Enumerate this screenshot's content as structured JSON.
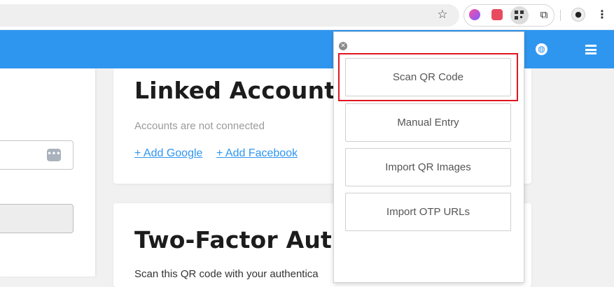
{
  "browser": {
    "icons": [
      "star-icon",
      "extension-icon",
      "extension-icon",
      "qr-extension-icon",
      "puzzle-icon",
      "profile-icon",
      "kebab-menu-icon"
    ]
  },
  "page": {
    "left_panel": {
      "input_icon": "dots-icon"
    },
    "linked_accounts": {
      "title": "Linked Accounts",
      "status": "Accounts are not connected",
      "add_google": "+ Add Google",
      "add_facebook": "+ Add Facebook"
    },
    "two_factor": {
      "title": "Two-Factor Auth",
      "description": "Scan this QR code with your authentica"
    },
    "header": {
      "accent_color": "#2f96f0",
      "icons": [
        "globe-icon",
        "hamburger-menu-icon"
      ]
    }
  },
  "popup": {
    "close_icon": "close-icon",
    "buttons": [
      "Scan QR Code",
      "Manual Entry",
      "Import QR Images",
      "Import OTP URLs"
    ],
    "highlight_color": "#e0161f"
  }
}
